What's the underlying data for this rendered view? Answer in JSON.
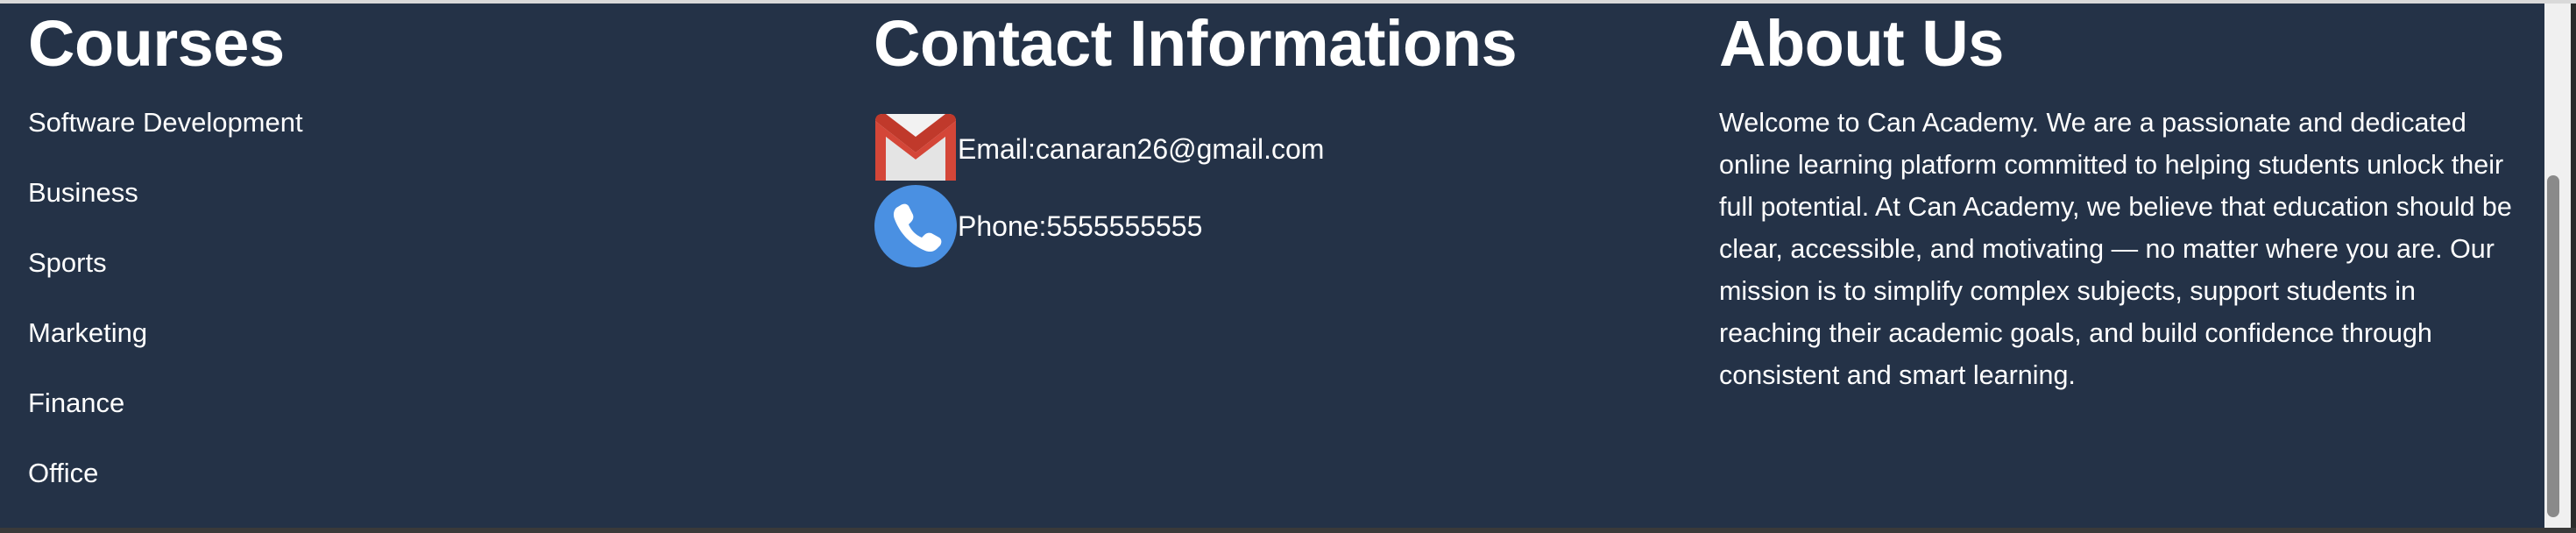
{
  "courses": {
    "heading": "Courses",
    "items": [
      {
        "label": "Software Development"
      },
      {
        "label": "Business"
      },
      {
        "label": "Sports"
      },
      {
        "label": "Marketing"
      },
      {
        "label": "Finance"
      },
      {
        "label": "Office"
      }
    ]
  },
  "contact": {
    "heading": "Contact Informations",
    "email": {
      "text": "Email:canaran26@gmail.com",
      "icon": "gmail-icon"
    },
    "phone": {
      "text": "Phone:5555555555",
      "icon": "phone-icon"
    }
  },
  "about": {
    "heading": "About Us",
    "text": "Welcome to Can Academy. We are a passionate and dedicated online learning platform committed to helping students unlock their full potential. At Can Academy, we believe that education should be clear, accessible, and motivating — no matter where you are. Our mission is to simplify complex subjects, support students in reaching their academic goals, and build confidence through consistent and smart learning."
  },
  "colors": {
    "footer_background": "#243247",
    "text": "#ffffff",
    "gmail_red": "#d44638",
    "phone_blue": "#4a90e2"
  }
}
